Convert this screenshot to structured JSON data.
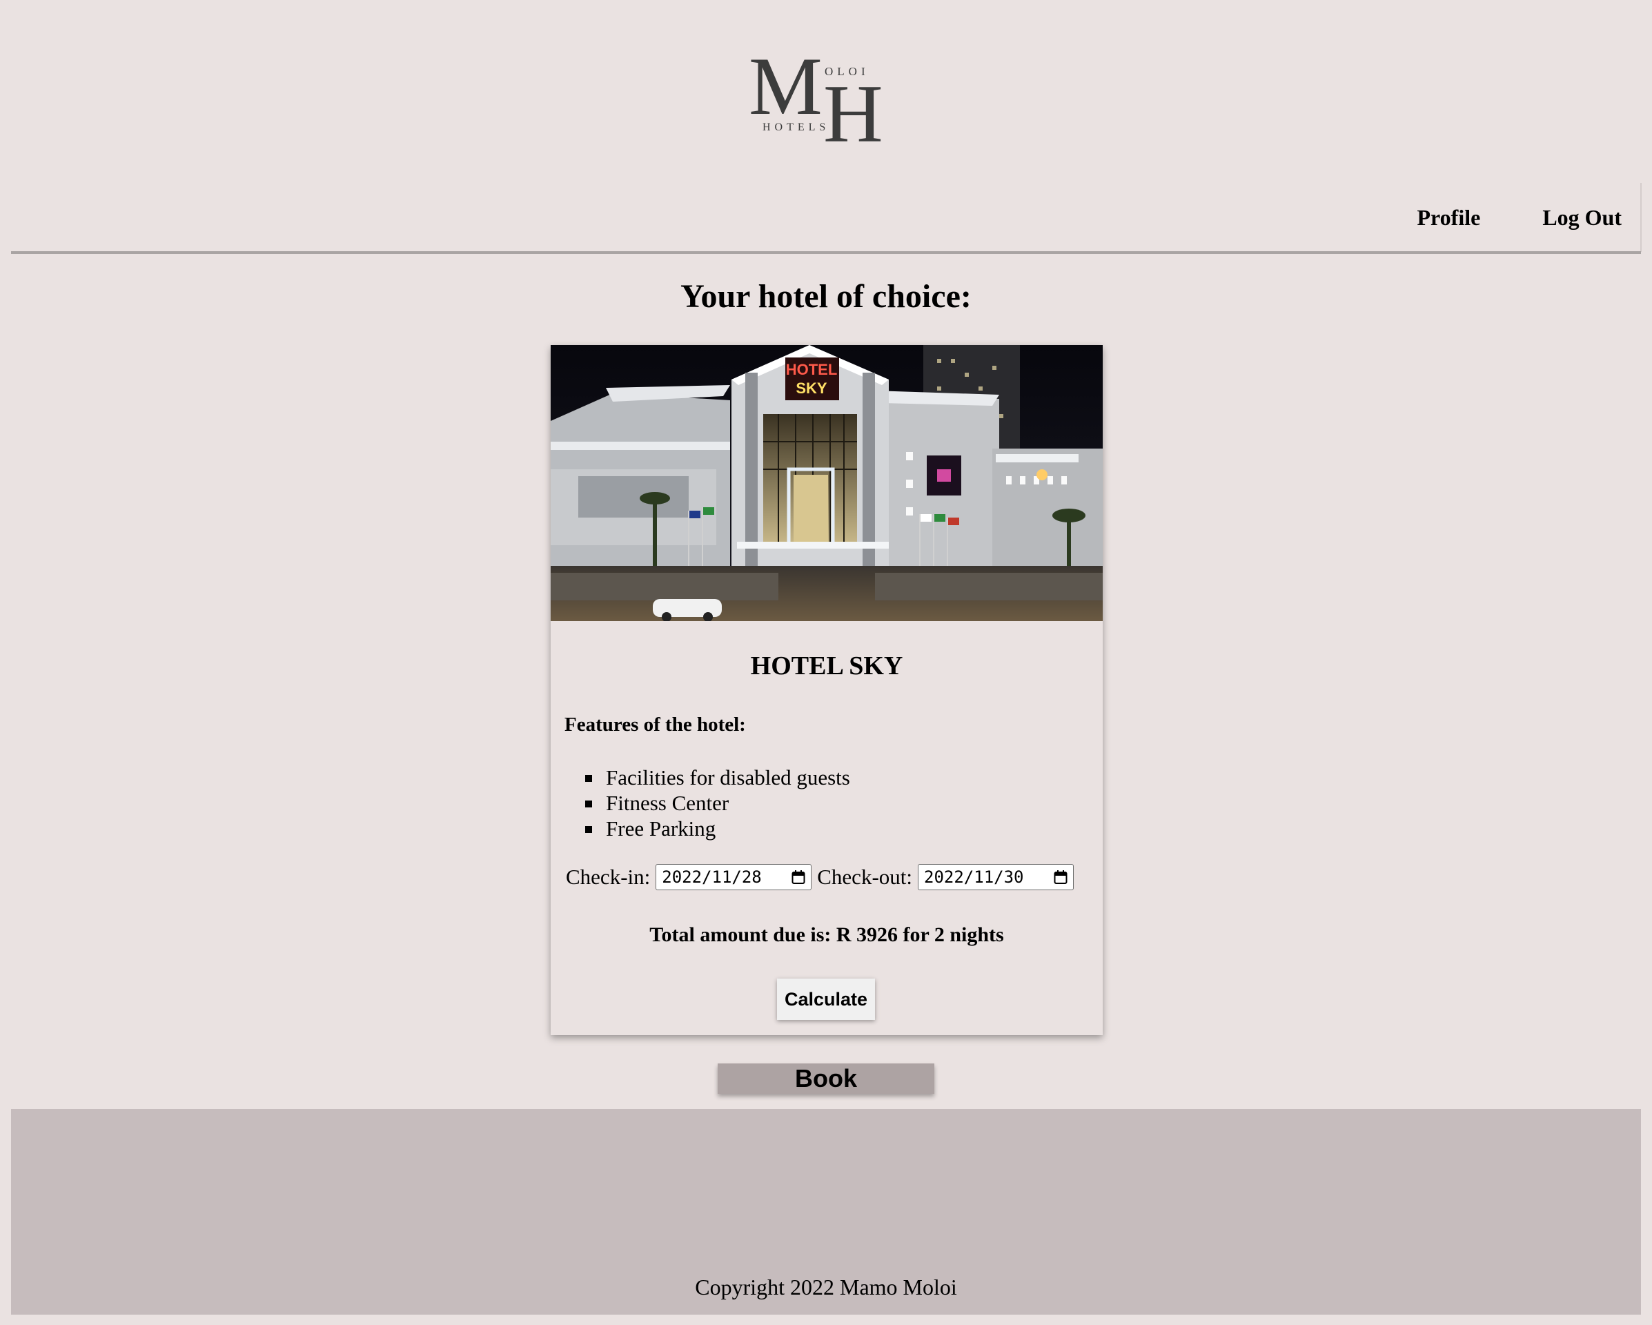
{
  "logo": {
    "big_m": "M",
    "big_h": "H",
    "small_top": "OLOI",
    "small_bottom": "HOTELS"
  },
  "nav": {
    "items": [
      {
        "label": "Profile"
      },
      {
        "label": "Log Out"
      }
    ]
  },
  "page": {
    "title": "Your hotel of choice:"
  },
  "hotel": {
    "sign_line1": "HOTEL",
    "sign_line2": "SKY",
    "name": "HOTEL SKY",
    "features_title": "Features of the hotel:",
    "features": [
      "Facilities for disabled guests",
      "Fitness Center",
      "Free Parking"
    ]
  },
  "booking": {
    "checkin_label": "Check-in:",
    "checkin_value": "2022/11/28",
    "checkout_label": "Check-out:",
    "checkout_value": "2022/11/30",
    "total_text": "Total amount due is: R 3926 for 2 nights",
    "calculate_label": "Calculate",
    "book_label": "Book"
  },
  "footer": {
    "copyright": "Copyright 2022 Mamo Moloi"
  },
  "colors": {
    "page_bg": "#eae2e1",
    "footer_bg": "#c6bcbd",
    "book_button_bg": "#ada3a3",
    "nav_rule": "#a9a4a3"
  }
}
